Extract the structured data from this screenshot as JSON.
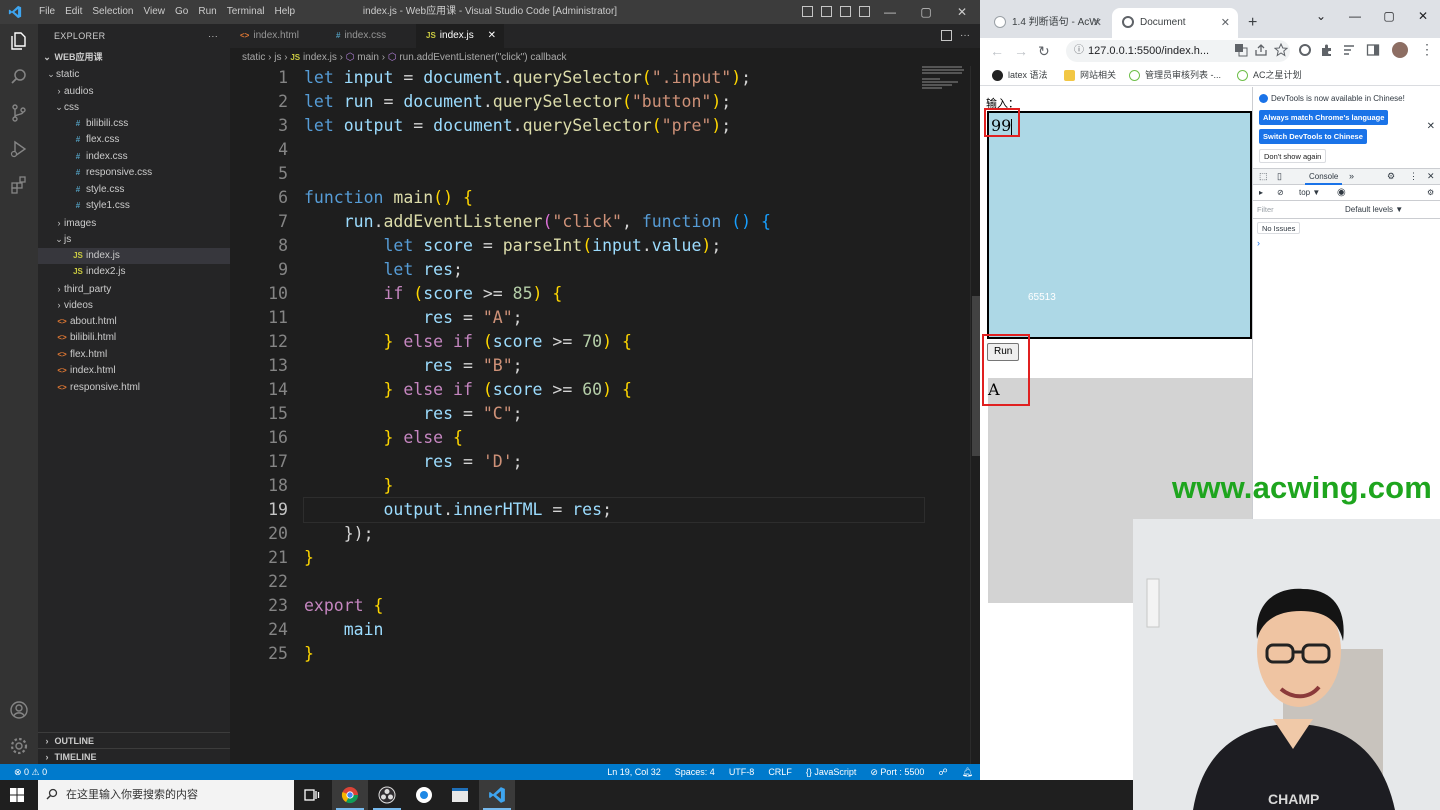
{
  "vscode": {
    "menu": [
      "File",
      "Edit",
      "Selection",
      "View",
      "Go",
      "Run",
      "Terminal",
      "Help"
    ],
    "window_title": "index.js - Web应用课 - Visual Studio Code [Administrator]",
    "explorer_title": "EXPLORER",
    "explorer_more": "···",
    "project": "WEB应用课",
    "tree": [
      {
        "label": "static",
        "tw": "⌄",
        "icon": "",
        "indent": 0
      },
      {
        "label": "audios",
        "tw": "›",
        "icon": "",
        "indent": 1
      },
      {
        "label": "css",
        "tw": "⌄",
        "icon": "",
        "indent": 1
      },
      {
        "label": "bilibili.css",
        "tw": "",
        "icon": "#",
        "indent": 2
      },
      {
        "label": "flex.css",
        "tw": "",
        "icon": "#",
        "indent": 2
      },
      {
        "label": "index.css",
        "tw": "",
        "icon": "#",
        "indent": 2
      },
      {
        "label": "responsive.css",
        "tw": "",
        "icon": "#",
        "indent": 2
      },
      {
        "label": "style.css",
        "tw": "",
        "icon": "#",
        "indent": 2
      },
      {
        "label": "style1.css",
        "tw": "",
        "icon": "#",
        "indent": 2
      },
      {
        "label": "images",
        "tw": "›",
        "icon": "",
        "indent": 1
      },
      {
        "label": "js",
        "tw": "⌄",
        "icon": "",
        "indent": 1
      },
      {
        "label": "index.js",
        "tw": "",
        "icon": "JS",
        "indent": 2
      },
      {
        "label": "index2.js",
        "tw": "",
        "icon": "JS",
        "indent": 2
      },
      {
        "label": "third_party",
        "tw": "›",
        "icon": "",
        "indent": 1
      },
      {
        "label": "videos",
        "tw": "›",
        "icon": "",
        "indent": 1
      },
      {
        "label": "about.html",
        "tw": "",
        "icon": "<>",
        "indent": 0
      },
      {
        "label": "bilibili.html",
        "tw": "",
        "icon": "<>",
        "indent": 0
      },
      {
        "label": "flex.html",
        "tw": "",
        "icon": "<>",
        "indent": 0
      },
      {
        "label": "index.html",
        "tw": "",
        "icon": "<>",
        "indent": 0
      },
      {
        "label": "responsive.html",
        "tw": "",
        "icon": "<>",
        "indent": 0
      }
    ],
    "outline": "OUTLINE",
    "timeline": "TIMELINE",
    "tabs": [
      {
        "label": "index.html",
        "icon": "<>"
      },
      {
        "label": "index.css",
        "icon": "#"
      },
      {
        "label": "index.js",
        "icon": "JS",
        "close": "✕"
      }
    ],
    "breadcrumb": {
      "p1": "static",
      "p2": "js",
      "file_icon": "JS",
      "p3": "index.js",
      "p4": "main",
      "p5": "run.addEventListener(\"click\") callback"
    },
    "code": {
      "t_let": "let",
      "t_input": "input",
      "t_eq": "=",
      "t_document": "document",
      "t_dot": ".",
      "t_qs": "querySelector",
      "t_lp": "(",
      "t_rp": ")",
      "t_semi": ";",
      "t_s_input": "\".input\"",
      "t_run": "run",
      "t_s_button": "\"button\"",
      "t_output": "output",
      "t_s_pre": "\"pre\"",
      "t_function": "function",
      "t_main": "main",
      "t_lb": "{",
      "t_rb": "}",
      "t_ael": "addEventListener",
      "t_s_click": "\"click\"",
      "t_comma": ",",
      "t_score": "score",
      "t_parseInt": "parseInt",
      "t_value": "value",
      "t_res": "res",
      "t_if": "if",
      "t_else": "else",
      "t_ge": ">=",
      "t_85": "85",
      "t_70": "70",
      "t_60": "60",
      "t_sA": "\"A\"",
      "t_sB": "\"B\"",
      "t_sC": "\"C\"",
      "t_sD": "'D'",
      "t_innerHTML": "innerHTML",
      "t_export": "export",
      "t_close_call": "});"
    },
    "line_numbers": [
      "1",
      "2",
      "3",
      "4",
      "5",
      "6",
      "7",
      "8",
      "9",
      "10",
      "11",
      "12",
      "13",
      "14",
      "15",
      "16",
      "17",
      "18",
      "19",
      "20",
      "21",
      "22",
      "23",
      "24",
      "25"
    ],
    "status": {
      "problems": "⊗ 0 ⚠ 0",
      "position": "Ln 19, Col 32",
      "spaces": "Spaces: 4",
      "encoding": "UTF-8",
      "eol": "CRLF",
      "language": "{} JavaScript",
      "port": "⊘ Port : 5500"
    }
  },
  "chrome": {
    "tabs": [
      {
        "label": "1.4 判断语句 - AcW",
        "close": "✕"
      },
      {
        "label": "Document",
        "close": "✕"
      }
    ],
    "new_tab": "+",
    "url": "127.0.0.1:5500/index.h...",
    "bookmarks": [
      "latex 语法",
      "网站相关",
      "管理员审核列表 -...",
      "AC之星计划"
    ],
    "page": {
      "label": "输入：",
      "input_value": "99",
      "floating_text": "65513",
      "run_button": "Run",
      "output": "A"
    },
    "devtools": {
      "banner": "DevTools is now available in Chinese!",
      "btn_match": "Always match Chrome's language",
      "btn_switch": "Switch DevTools to Chinese",
      "btn_dont": "Don't show again",
      "console_tab": "Console",
      "context": "top ▼",
      "filter_placeholder": "Filter",
      "levels": "Default levels ▼",
      "issues": "No Issues",
      "prompt": "›"
    }
  },
  "watermark": "www.acwing.com",
  "taskbar": {
    "search_placeholder": "在这里输入你要搜索的内容"
  },
  "colors": {
    "vscode_bg": "#1e1e1e",
    "statusbar": "#007acc",
    "page_input_bg": "#add8e6",
    "page_output_bg": "#d3d3d3",
    "highlight_box": "#e02020",
    "watermark": "#1ea51e"
  }
}
